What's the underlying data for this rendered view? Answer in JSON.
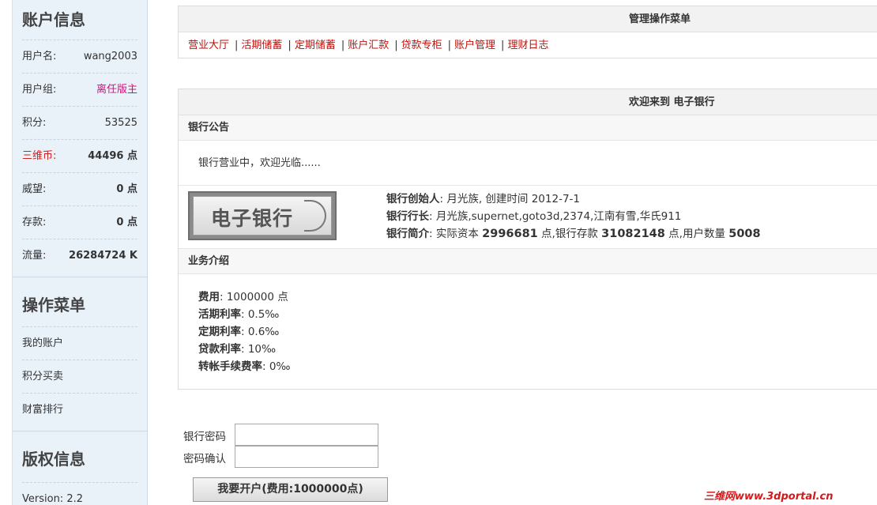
{
  "sidebar": {
    "account_title": "账户信息",
    "rows": [
      {
        "label": "用户名:",
        "value": "wang2003"
      },
      {
        "label": "用户组:",
        "value": "离任版主"
      },
      {
        "label": "积分:",
        "value": "53525"
      },
      {
        "label": "三维币:",
        "value": "44496 点"
      },
      {
        "label": "威望:",
        "value": "0 点"
      },
      {
        "label": "存款:",
        "value": "0 点"
      },
      {
        "label": "流量:",
        "value": "26284724 K"
      }
    ],
    "menu_title": "操作菜单",
    "menu_items": [
      "我的账户",
      "积分买卖",
      "财富排行"
    ],
    "copyright_title": "版权信息",
    "version": "Version: 2.2"
  },
  "admin_menu": {
    "title": "管理操作菜单",
    "links": [
      "营业大厅",
      "活期储蓄",
      "定期储蓄",
      "账户汇款",
      "贷款专柜",
      "账户管理",
      "理财日志"
    ],
    "separator": "|"
  },
  "welcome": {
    "title": "欢迎来到 电子银行",
    "notice_heading": "银行公告",
    "notice_text": "银行营业中，欢迎光临......",
    "logo_text": "电子银行",
    "founder_label": "银行创始人",
    "founder_value": ": 月光族, 创建时间 2012-7-1",
    "director_label": "银行行长",
    "director_value": ": 月光族,supernet,goto3d,2374,江南有雪,华氏911",
    "intro_label": "银行简介",
    "intro_prefix": ": 实际资本 ",
    "capital": "2996681",
    "intro_mid1": " 点,银行存款 ",
    "deposits": "31082148",
    "intro_mid2": " 点,用户数量 ",
    "users": "5008",
    "business_heading": "业务介绍",
    "business": [
      {
        "label": "费用",
        "value": ": 1000000 点"
      },
      {
        "label": "活期利率",
        "value": ": 0.5‰"
      },
      {
        "label": "定期利率",
        "value": ": 0.6‰"
      },
      {
        "label": "贷款利率",
        "value": ": 10‰"
      },
      {
        "label": "转帐手续费率",
        "value": ": 0‰"
      }
    ]
  },
  "form": {
    "password_label": "银行密码",
    "confirm_label": "密码确认",
    "submit_label": "我要开户(费用:1000000点)"
  },
  "watermark": "三维网www.3dportal.cn",
  "colors": {
    "link_red": "#c0120c",
    "usergroup_pink": "#d0157a",
    "coin_red": "#cc2222",
    "sidebar_bg": "#e9f1f9"
  }
}
